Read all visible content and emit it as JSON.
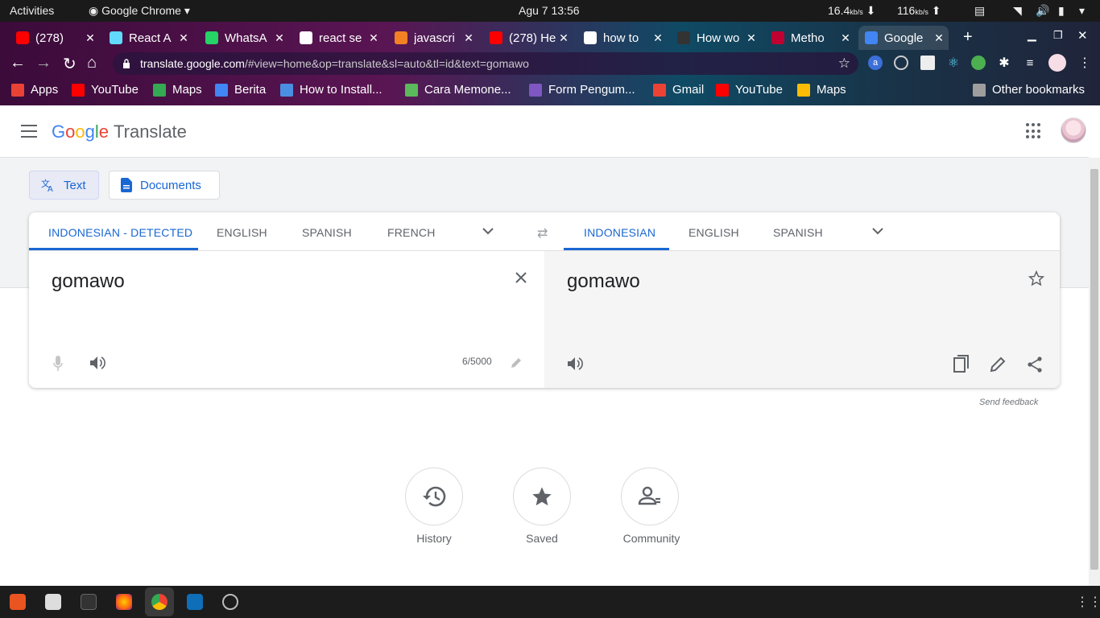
{
  "system_bar": {
    "activities": "Activities",
    "app_name": "Google Chrome",
    "clock": "Agu 7  13:56",
    "net_down": "16.4",
    "net_down_unit": "kb/s",
    "net_up": "116",
    "net_up_unit": "kb/s"
  },
  "tabs": [
    {
      "title": "(278)",
      "color": "#ff0000"
    },
    {
      "title": "React A",
      "color": "#61dafb"
    },
    {
      "title": "WhatsA",
      "color": "#25d366"
    },
    {
      "title": "react se",
      "color": "#ffffff"
    },
    {
      "title": "javascri",
      "color": "#f48024"
    },
    {
      "title": "(278) He",
      "color": "#ff0000"
    },
    {
      "title": "how to",
      "color": "#ffffff"
    },
    {
      "title": "How wo",
      "color": "#333333"
    },
    {
      "title": "Metho",
      "color": "#c00030"
    },
    {
      "title": "Google",
      "color": "#4285f4",
      "active": true
    }
  ],
  "omnibox": {
    "domain": "translate.google.com",
    "path": "/#view=home&op=translate&sl=auto&tl=id&text=gomawo"
  },
  "bookmarks": [
    {
      "label": "Apps",
      "color": "#ea4335"
    },
    {
      "label": "YouTube",
      "color": "#ff0000"
    },
    {
      "label": "Maps",
      "color": "#34a853"
    },
    {
      "label": "Berita",
      "color": "#4285f4"
    },
    {
      "label": "How to Install...",
      "color": "#4a90e2"
    },
    {
      "label": "Cara Memone...",
      "color": "#5cb85c"
    },
    {
      "label": "Form Pengum...",
      "color": "#7e57c2"
    },
    {
      "label": "Gmail",
      "color": "#ea4335"
    },
    {
      "label": "YouTube",
      "color": "#ff0000"
    },
    {
      "label": "Maps",
      "color": "#fbbc05"
    },
    {
      "label": "Other bookmarks",
      "color": "#9e9e9e"
    }
  ],
  "header": {
    "logo": "Google",
    "product": "Translate"
  },
  "mode_buttons": {
    "text": "Text",
    "documents": "Documents"
  },
  "source_langs": [
    "INDONESIAN - DETECTED",
    "ENGLISH",
    "SPANISH",
    "FRENCH"
  ],
  "target_langs": [
    "INDONESIAN",
    "ENGLISH",
    "SPANISH"
  ],
  "source_text": "gomawo",
  "target_text": "gomawo",
  "char_counter": "6/5000",
  "feedback": "Send feedback",
  "shortcuts": {
    "history": "History",
    "saved": "Saved",
    "community": "Community"
  },
  "colors": {
    "accent": "#1967d2"
  }
}
